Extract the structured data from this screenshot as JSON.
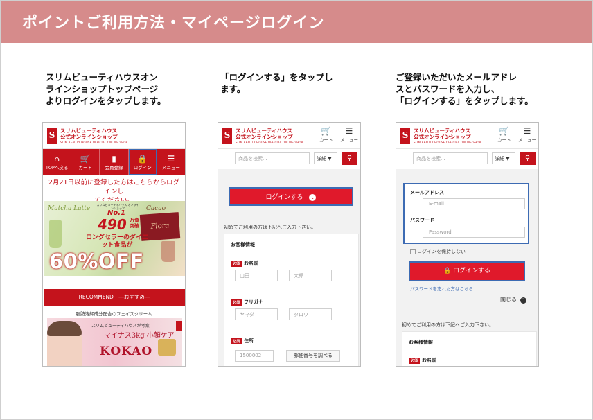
{
  "slide": {
    "title": "ポイントご利用方法・マイページログイン",
    "step1_text": [
      "スリムビューティハウスオン",
      "ラインショップトップページ",
      "よりログインをタップします。"
    ],
    "step2_text": [
      "「ログインする」をタップし",
      "ます。"
    ],
    "step3_text": [
      "ご登録いただいたメールアドレ",
      "スとパスワードを入力し、",
      "「ログインする」をタップします。"
    ]
  },
  "shop": {
    "logo_letter": "S",
    "name_line1": "スリムビューティハウス",
    "name_line2": "公式オンラインショップ",
    "name_en": "SLIM BEAUTY HOUSE OFFICIAL ONLINE SHOP",
    "cart_label": "カート",
    "menu_label": "メニュー",
    "cart_icon": "cart-icon",
    "menu_icon": "hamburger-icon"
  },
  "screen1": {
    "nav": [
      {
        "label": "TOPへ戻る",
        "icon": "home-icon",
        "glyph": "⌂"
      },
      {
        "label": "カート",
        "icon": "cart-icon",
        "glyph": "🛒"
      },
      {
        "label": "会員登録",
        "icon": "book-icon",
        "glyph": "▮"
      },
      {
        "label": "ログイン",
        "icon": "lock-icon",
        "glyph": "🔒"
      },
      {
        "label": "メニュー",
        "icon": "hamburger-icon",
        "glyph": "☰"
      }
    ],
    "highlighted_nav_index": 3,
    "notice": [
      "2月21日以前に登録した方はこちらからログインし",
      "てください。"
    ],
    "promo": {
      "matcha": "Matcha Latte",
      "cacao": "Cacao",
      "no1_caption": "スリムビューティハウス オンラインショップ",
      "no1": "No.1",
      "count": "490",
      "count_unit": "万食突破",
      "subtitle": "ロングセラーのダイエット食品が",
      "flora": "Flora",
      "discount": "60%OFF"
    },
    "recommend": "RECOMMEND　―おすすめ―",
    "subcopy": "脂肪溶解成分配合のフェイスクリーム",
    "kokao": {
      "line1": "スリムビューティハウスが考案",
      "line2": "マイナス3kg 小顔ケア",
      "name": "KOKAO"
    }
  },
  "screen2": {
    "search_placeholder": "商品を検索...",
    "detail_label": "詳細 ▼",
    "search_icon": "search-icon",
    "login_button": "ログインする",
    "first_time": "初めてご利用の方は下記へご入力下さい。",
    "customer_info": "お客様情報",
    "required_badge": "必須",
    "fields": {
      "name_label": "お名前",
      "last_name_ph": "山田",
      "first_name_ph": "太郎",
      "kana_label": "フリガナ",
      "last_kana_ph": "ヤマダ",
      "first_kana_ph": "タロウ",
      "address_label": "住所",
      "zip_ph": "1500002",
      "zip_lookup": "郵便番号を調べる"
    }
  },
  "screen3": {
    "email_label": "メールアドレス",
    "email_placeholder": "E-mail",
    "password_label": "パスワード",
    "password_placeholder": "Password",
    "remember_label": "ログインを保持しない",
    "login_button": "ログインする",
    "forgot_link": "パスワードを忘れた方はこちら",
    "close_label": "閉じる",
    "first_time": "初めてご利用の方は下記へご入力下さい。",
    "customer_info": "お客様情報",
    "name_label": "お名前"
  },
  "colors": {
    "banner": "#d68b8b",
    "brand_red": "#c4131c",
    "button_red": "#e0192b",
    "highlight_blue": "#3d6bb3"
  }
}
